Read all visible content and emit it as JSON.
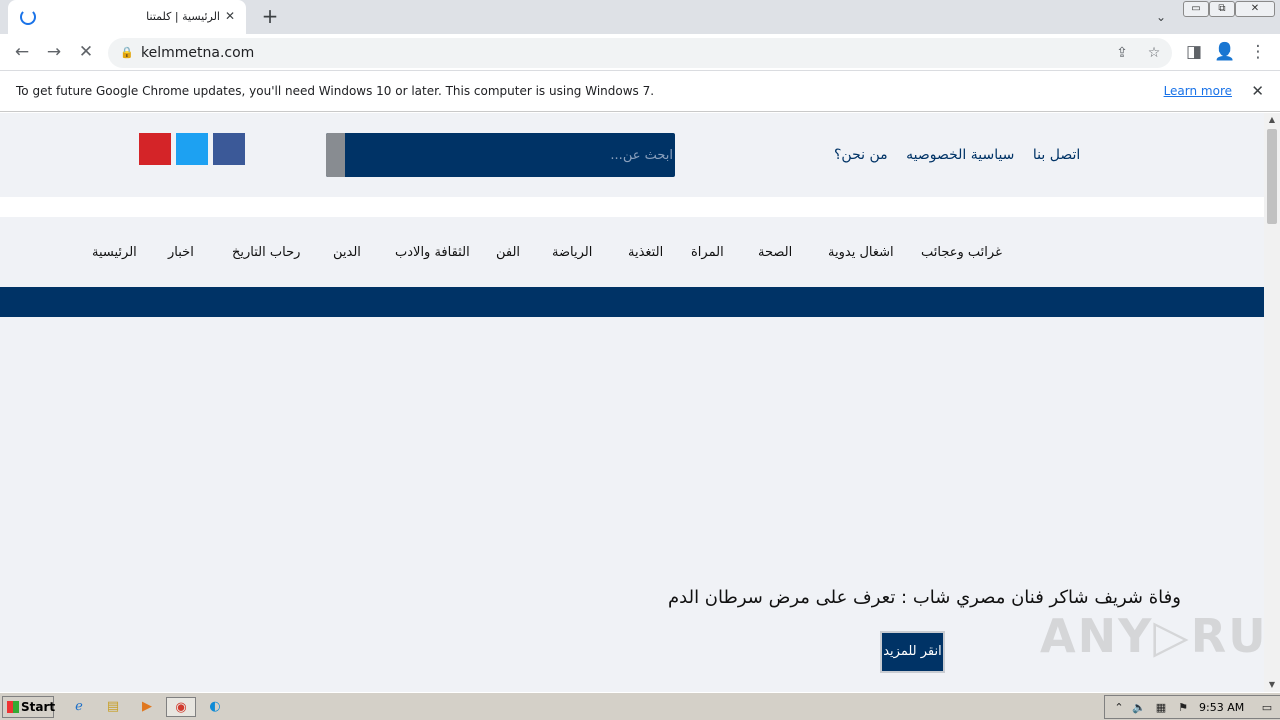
{
  "browser": {
    "tab_title": "الرئيسية | كلمتنا",
    "tab_close": "✕",
    "new_tab": "+",
    "tab_search": "⌄",
    "url": "kelmmetna.com",
    "window_controls": [
      "▭",
      "⧉",
      "✕"
    ]
  },
  "toolbar": {
    "back": "←",
    "forward": "→",
    "stop": "✕",
    "lock": "🔒",
    "share": "⇪",
    "bookmark": "☆",
    "sidepanel": "◨",
    "profile": "👤",
    "menu": "⋮"
  },
  "infobar": {
    "message": "To get future Google Chrome updates, you'll need Windows 10 or later. This computer is using Windows 7.",
    "learn_more": "Learn more",
    "close": "✕"
  },
  "site": {
    "colors": {
      "primary": "#003366",
      "youtube": "#d42428",
      "twitter": "#1da1f2",
      "facebook": "#3b5998"
    },
    "search_placeholder": "ابحث عن...",
    "top_links": [
      "اتصل بنا",
      "سياسية الخصوصيه",
      "من نحن؟"
    ],
    "nav_items": [
      "الرئيسية",
      "اخبار",
      "رحاب التاريخ",
      "الدين",
      "الثقافة والادب",
      "الفن",
      "الرياضة",
      "التغذية",
      "المراة",
      "الصحة",
      "اشغال يدوية",
      "غرائب وعجائب"
    ],
    "headline": "وفاة شريف شاكر فنان مصري شاب : تعرف على مرض سرطان الدم",
    "read_more": "انقر للمزيد",
    "watermark": "ANY▷RUN"
  },
  "scrollbar": {
    "up": "▲",
    "down": "▼"
  },
  "taskbar": {
    "start_label": "Start",
    "clock": "9:53 AM",
    "apps": [
      "ie-icon",
      "explorer-icon",
      "media-player-icon",
      "chrome-icon",
      "edge-icon"
    ]
  }
}
